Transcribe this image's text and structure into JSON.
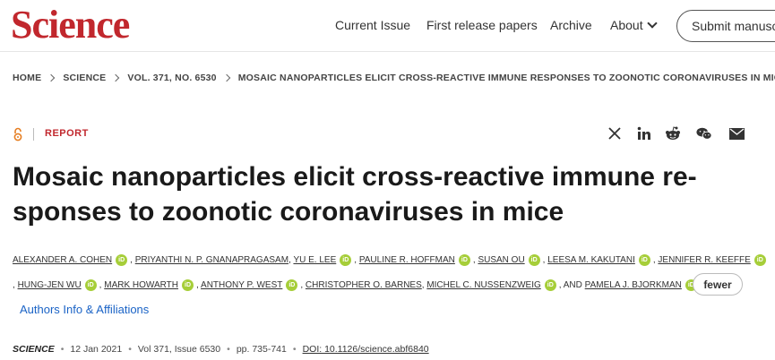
{
  "header": {
    "logo": "Science",
    "nav": {
      "current_issue": "Current Issue",
      "first_release": "First release papers",
      "archive": "Archive",
      "about": "About"
    },
    "submit_label": "Submit manuscript"
  },
  "breadcrumb": [
    "HOME",
    "SCIENCE",
    "VOL. 371, NO. 6530",
    "MOSAIC NANOPARTICLES ELICIT CROSS-REACTIVE IMMUNE RESPONSES TO ZOONOTIC CORONAVIRUSES IN MICE"
  ],
  "article": {
    "type": "REPORT",
    "title": "Mosaic nanoparticles elicit cross-reactive immune re-sponses to zoonotic coronaviruses in mice",
    "authors_line1": [
      {
        "name": "ALEXANDER A. COHEN",
        "orcid": true
      },
      {
        "name": "PRIYANTHI N. P. GNANAPRAGASAM",
        "orcid": false
      },
      {
        "name": "YU E. LEE",
        "orcid": true
      },
      {
        "name": "PAULINE R. HOFFMAN",
        "orcid": true
      },
      {
        "name": "SUSAN OU",
        "orcid": true
      },
      {
        "name": "LEESA M. KAKUTANI",
        "orcid": true
      },
      {
        "name": "JENNIFER R. KEEFFE",
        "orcid": true
      }
    ],
    "authors_line2": [
      {
        "name": "HUNG-JEN WU",
        "orcid": true
      },
      {
        "name": "MARK HOWARTH",
        "orcid": true
      },
      {
        "name": "ANTHONY P. WEST",
        "orcid": true
      },
      {
        "name": "CHRISTOPHER O. BARNES",
        "orcid": false
      },
      {
        "name": "MICHEL C. NUSSENZWEIG",
        "orcid": true
      },
      {
        "name": "PAMELA J. BJORKMAN",
        "orcid": true
      }
    ],
    "and_label": "AND",
    "fewer_label": "fewer",
    "affiliations_link": "Authors Info & Affiliations",
    "citation": {
      "journal": "SCIENCE",
      "date": "12 Jan 2021",
      "volume": "Vol 371, Issue 6530",
      "pages": "pp. 735-741",
      "doi": "DOI: 10.1126/science.abf6840"
    }
  },
  "share_icons": [
    "x-icon",
    "linkedin-icon",
    "reddit-icon",
    "wechat-icon",
    "email-icon"
  ],
  "colors": {
    "brand_red": "#c1272d",
    "orcid_green": "#a6ce39",
    "link_blue": "#1a63c6",
    "open_access_orange": "#e67e22"
  }
}
